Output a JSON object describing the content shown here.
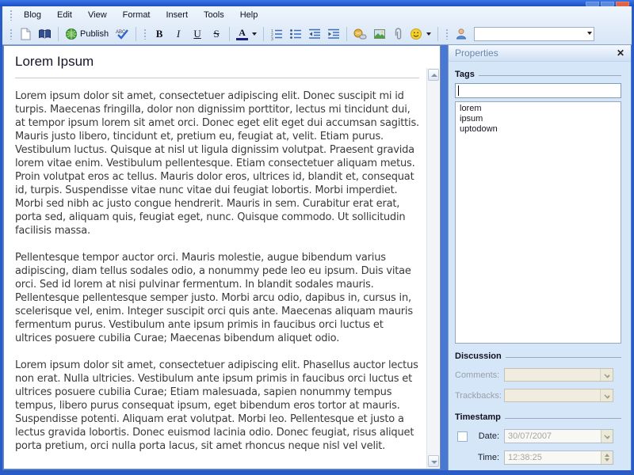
{
  "menu": {
    "items": [
      "Blog",
      "Edit",
      "View",
      "Format",
      "Insert",
      "Tools",
      "Help"
    ]
  },
  "toolbar": {
    "publish_label": "Publish",
    "bold": "B",
    "italic": "I",
    "underline": "U",
    "strikethrough": "S",
    "font_color_letter": "A",
    "style_combo_value": ""
  },
  "editor": {
    "title": "Lorem Ipsum",
    "paragraphs": [
      "Lorem ipsum dolor sit amet, consectetuer adipiscing elit. Donec suscipit mi id turpis. Maecenas fringilla, dolor non dignissim porttitor, lectus mi tincidunt dui, at tempor ipsum lorem sit amet orci. Donec eget elit eget dui accumsan sagittis. Mauris justo libero, tincidunt et, pretium eu, feugiat at, velit. Etiam purus. Vestibulum luctus. Quisque at nisl ut ligula dignissim volutpat. Praesent gravida lorem vitae enim. Vestibulum pellentesque. Etiam consectetuer aliquam metus. Proin volutpat eros ac tellus. Mauris dolor eros, ultrices id, blandit et, consequat id, turpis. Suspendisse vitae nunc vitae dui feugiat lobortis. Morbi imperdiet. Morbi sed nibh ac justo congue hendrerit. Mauris in sem. Curabitur erat erat, porta sed, aliquam quis, feugiat eget, nunc. Quisque commodo. Ut sollicitudin facilisis massa.",
      "Pellentesque tempor auctor orci. Mauris molestie, augue bibendum varius adipiscing, diam tellus sodales odio, a nonummy pede leo eu ipsum. Duis vitae orci. Sed id lorem at nisi pulvinar fermentum. In blandit sodales mauris. Pellentesque pellentesque semper justo. Morbi arcu odio, dapibus in, cursus in, scelerisque vel, enim. Integer suscipit orci quis ante. Maecenas aliquam mauris fermentum purus. Vestibulum ante ipsum primis in faucibus orci luctus et ultrices posuere cubilia Curae; Maecenas bibendum aliquet odio.",
      "Lorem ipsum dolor sit amet, consectetuer adipiscing elit. Phasellus auctor lectus non erat. Nulla ultricies. Vestibulum ante ipsum primis in faucibus orci luctus et ultrices posuere cubilia Curae; Etiam malesuada, sapien nonummy tempus tempus, libero purus consequat ipsum, eget bibendum eros tortor at mauris. Suspendisse potenti. Aliquam erat volutpat. Morbi leo. Pellentesque et justo a lectus gravida lobortis. Donec euismod lacinia odio. Donec feugiat, risus aliquet porta pretium, orci nulla porta lacus, sit amet rhoncus neque nisl vel velit."
    ]
  },
  "properties_panel": {
    "title": "Properties",
    "close_glyph": "✕",
    "tags": {
      "label": "Tags",
      "input_value": "",
      "items": [
        "lorem",
        "ipsum",
        "uptodown"
      ]
    },
    "discussion": {
      "label": "Discussion",
      "comments_label": "Comments:",
      "comments_value": "",
      "trackbacks_label": "Trackbacks:",
      "trackbacks_value": ""
    },
    "timestamp": {
      "label": "Timestamp",
      "date_label": "Date:",
      "date_value": "30/07/2007",
      "time_label": "Time:",
      "time_value": "12:38:25"
    }
  },
  "colors": {
    "titlebar_blue": "#1b4fc4",
    "window_blue": "#2a5cc8",
    "chrome_blue": "#d8e6f6",
    "panel_blue": "#d5e6f8",
    "disabled_beige": "#ece9d8",
    "font_color_bar": "#1b1f7e"
  }
}
